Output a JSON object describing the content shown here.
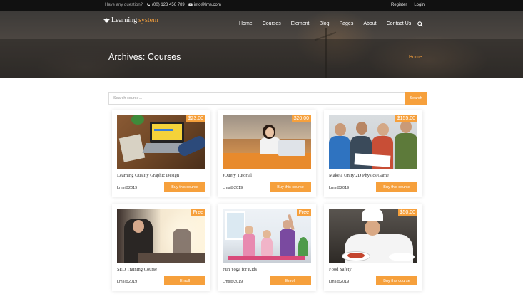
{
  "topbar": {
    "question": "Have any question?",
    "phone": "(00) 123 456 789",
    "email": "info@lms.com",
    "register": "Register",
    "login": "Login"
  },
  "logo": {
    "part1": "Learning",
    "part2": "system"
  },
  "nav": {
    "items": [
      "Home",
      "Courses",
      "Element",
      "Blog",
      "Pages",
      "About",
      "Contact Us"
    ]
  },
  "hero": {
    "title": "Archives: Courses",
    "breadcrumb": "Home"
  },
  "search": {
    "placeholder": "Search course...",
    "button": "Search"
  },
  "accent_color": "#f6a03c",
  "courses": [
    {
      "title": "Learning Quality Graphic Design",
      "price": "$23.00",
      "author": "Lms@2019",
      "action": "Buy this course"
    },
    {
      "title": "JQuery Tutorial",
      "price": "$20.00",
      "author": "Lms@2019",
      "action": "Buy this course"
    },
    {
      "title": "Make a Unity 2D Physics Game",
      "price": "$155.00",
      "author": "Lms@2019",
      "action": "Buy this course"
    },
    {
      "title": "SEO Training Course",
      "price": "Free",
      "author": "Lms@2019",
      "action": "Enroll"
    },
    {
      "title": "Fun Yoga for Kids",
      "price": "Free",
      "author": "Lms@2019",
      "action": "Enroll"
    },
    {
      "title": "Food Safety",
      "price": "$50.00",
      "author": "Lms@2019",
      "action": "Buy this course"
    }
  ]
}
